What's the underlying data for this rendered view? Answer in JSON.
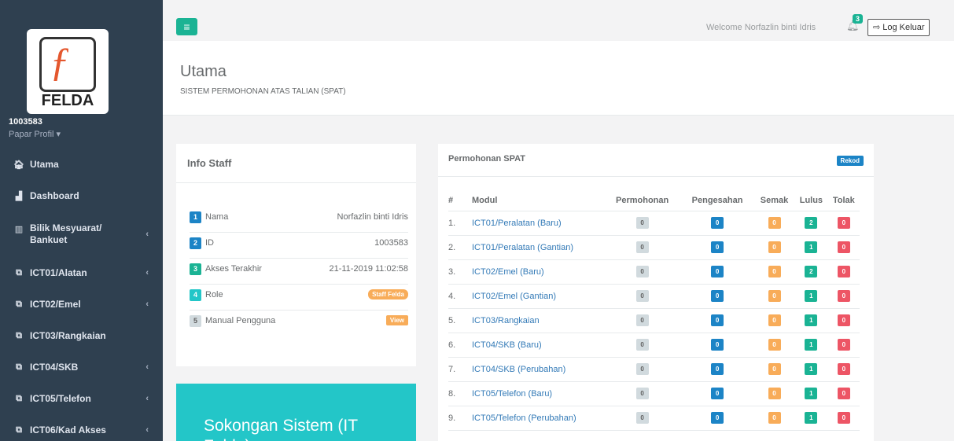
{
  "sidebar": {
    "logo_text": "FELDA",
    "user_id": "1003583",
    "profile_link": "Papar Profil ▾",
    "items": [
      {
        "label": "Utama",
        "icon": "home-icon",
        "glyph": "🏠︎",
        "chevron": false
      },
      {
        "label": "Dashboard",
        "icon": "chart-area-icon",
        "glyph": "▟",
        "chevron": false
      },
      {
        "label": "Bilik Mesyuarat/ Bankuet",
        "icon": "building-icon",
        "glyph": "▥",
        "chevron": true
      },
      {
        "label": "ICT01/Alatan",
        "icon": "clone-icon",
        "glyph": "⧉",
        "chevron": true
      },
      {
        "label": "ICT02/Emel",
        "icon": "clone-icon",
        "glyph": "⧉",
        "chevron": true
      },
      {
        "label": "ICT03/Rangkaian",
        "icon": "clone-icon",
        "glyph": "⧉",
        "chevron": false
      },
      {
        "label": "ICT04/SKB",
        "icon": "clone-icon",
        "glyph": "⧉",
        "chevron": true
      },
      {
        "label": "ICT05/Telefon",
        "icon": "clone-icon",
        "glyph": "⧉",
        "chevron": true
      },
      {
        "label": "ICT06/Kad Akses",
        "icon": "clone-icon",
        "glyph": "⧉",
        "chevron": true
      }
    ]
  },
  "topbar": {
    "menu_glyph": "≡",
    "welcome": "Welcome Norfazlin binti Idris",
    "notification_count": "3",
    "logout_label": "⇨ Log Keluar"
  },
  "heading": {
    "title": "Utama",
    "subtitle": "SISTEM PERMOHONAN ATAS TALIAN (SPAT)"
  },
  "info_staff": {
    "title": "Info Staff",
    "rows": [
      {
        "num": "1",
        "label": "Nama",
        "value": "Norfazlin binti Idris",
        "badge_color": "#1c84c6"
      },
      {
        "num": "2",
        "label": "ID",
        "value": "1003583",
        "badge_color": "#1c84c6"
      },
      {
        "num": "3",
        "label": "Akses Terakhir",
        "value": "21-11-2019 11:02:58",
        "badge_color": "#1ab394"
      },
      {
        "num": "4",
        "label": "Role",
        "value": "Staff Felda",
        "badge_color": "#23c6c8"
      },
      {
        "num": "5",
        "label": "Manual Pengguna",
        "value": "View",
        "badge_color": "#d1dade"
      }
    ]
  },
  "support": {
    "title": "Sokongan Sistem (IT Felda)"
  },
  "spat": {
    "title": "Permohonan SPAT",
    "rekod_label": "Rekod",
    "headers": [
      "#",
      "Modul",
      "Permohonan",
      "Pengesahan",
      "Semak",
      "Lulus",
      "Tolak"
    ],
    "rows": [
      {
        "n": "1.",
        "modul": "ICT01/Peralatan (Baru)",
        "permohonan": "0",
        "pengesahan": "0",
        "semak": "0",
        "lulus": "2",
        "tolak": "0"
      },
      {
        "n": "2.",
        "modul": "ICT01/Peralatan (Gantian)",
        "permohonan": "0",
        "pengesahan": "0",
        "semak": "0",
        "lulus": "1",
        "tolak": "0"
      },
      {
        "n": "3.",
        "modul": "ICT02/Emel (Baru)",
        "permohonan": "0",
        "pengesahan": "0",
        "semak": "0",
        "lulus": "2",
        "tolak": "0"
      },
      {
        "n": "4.",
        "modul": "ICT02/Emel (Gantian)",
        "permohonan": "0",
        "pengesahan": "0",
        "semak": "0",
        "lulus": "1",
        "tolak": "0"
      },
      {
        "n": "5.",
        "modul": "ICT03/Rangkaian",
        "permohonan": "0",
        "pengesahan": "0",
        "semak": "0",
        "lulus": "1",
        "tolak": "0"
      },
      {
        "n": "6.",
        "modul": "ICT04/SKB (Baru)",
        "permohonan": "0",
        "pengesahan": "0",
        "semak": "0",
        "lulus": "1",
        "tolak": "0"
      },
      {
        "n": "7.",
        "modul": "ICT04/SKB (Perubahan)",
        "permohonan": "0",
        "pengesahan": "0",
        "semak": "0",
        "lulus": "1",
        "tolak": "0"
      },
      {
        "n": "8.",
        "modul": "ICT05/Telefon (Baru)",
        "permohonan": "0",
        "pengesahan": "0",
        "semak": "0",
        "lulus": "1",
        "tolak": "0"
      },
      {
        "n": "9.",
        "modul": "ICT05/Telefon (Perubahan)",
        "permohonan": "0",
        "pengesahan": "0",
        "semak": "0",
        "lulus": "1",
        "tolak": "0"
      }
    ]
  }
}
